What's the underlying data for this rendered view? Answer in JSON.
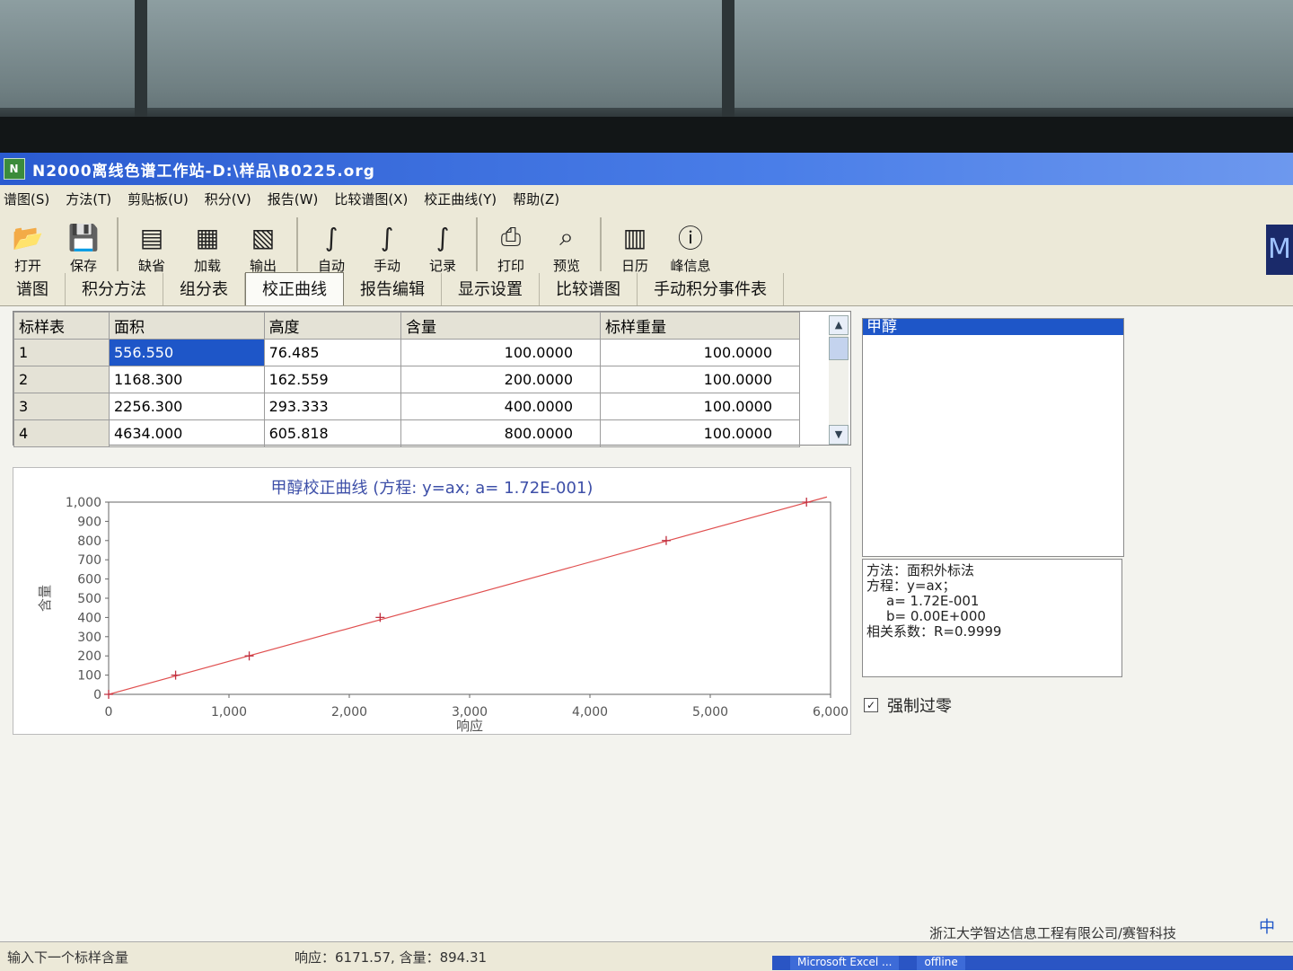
{
  "window": {
    "title": "N2000离线色谱工作站-D:\\样品\\B0225.org"
  },
  "menu": [
    "谱图(S)",
    "方法(T)",
    "剪贴板(U)",
    "积分(V)",
    "报告(W)",
    "比较谱图(X)",
    "校正曲线(Y)",
    "帮助(Z)"
  ],
  "toolbar": [
    {
      "label": "打开",
      "icon": "open-folder-icon"
    },
    {
      "label": "保存",
      "icon": "save-icon"
    },
    {
      "sep": true
    },
    {
      "label": "缺省",
      "icon": "document-icon"
    },
    {
      "label": "加载",
      "icon": "load-icon"
    },
    {
      "label": "输出",
      "icon": "export-icon"
    },
    {
      "sep": true
    },
    {
      "label": "自动",
      "icon": "auto-integrate-icon"
    },
    {
      "label": "手动",
      "icon": "manual-integrate-icon"
    },
    {
      "label": "记录",
      "icon": "record-icon"
    },
    {
      "sep": true
    },
    {
      "label": "打印",
      "icon": "printer-icon"
    },
    {
      "label": "预览",
      "icon": "preview-icon"
    },
    {
      "sep": true
    },
    {
      "label": "日历",
      "icon": "calendar-icon"
    },
    {
      "label": "峰信息",
      "icon": "info-icon"
    }
  ],
  "tabs": [
    "谱图",
    "积分方法",
    "组分表",
    "校正曲线",
    "报告编辑",
    "显示设置",
    "比较谱图",
    "手动积分事件表"
  ],
  "active_tab": "校正曲线",
  "grid": {
    "headers": [
      "标样表",
      "面积",
      "高度",
      "含量",
      "标样重量"
    ],
    "rows": [
      [
        "1",
        "556.550",
        "76.485",
        "100.0000",
        "100.0000"
      ],
      [
        "2",
        "1168.300",
        "162.559",
        "200.0000",
        "100.0000"
      ],
      [
        "3",
        "2256.300",
        "293.333",
        "400.0000",
        "100.0000"
      ],
      [
        "4",
        "4634.000",
        "605.818",
        "800.0000",
        "100.0000"
      ]
    ]
  },
  "component": "甲醇",
  "info": {
    "method": "方法：面积外标法",
    "equation": "方程：y=ax；",
    "a": "a= 1.72E-001",
    "b": "b= 0.00E+000",
    "corr": "相关系数：R=0.9999"
  },
  "force_zero": "强制过零",
  "chart_data": {
    "type": "scatter",
    "title": "甲醇校正曲线 (方程: y=ax; a= 1.72E-001)",
    "xlabel": "响应",
    "ylabel": "含量",
    "xlim": [
      0,
      6000
    ],
    "ylim": [
      0,
      1000
    ],
    "xticks": [
      "0",
      "1,000",
      "2,000",
      "3,000",
      "4,000",
      "5,000",
      "6,000"
    ],
    "yticks": [
      "0",
      "100",
      "200",
      "300",
      "400",
      "500",
      "600",
      "700",
      "800",
      "900",
      "1,000"
    ],
    "points": [
      [
        0,
        0
      ],
      [
        556.55,
        100
      ],
      [
        1168.3,
        200
      ],
      [
        2256.3,
        400
      ],
      [
        4634,
        800
      ],
      [
        5800,
        1000
      ]
    ],
    "fit": {
      "slope": 0.172,
      "intercept": 0,
      "color": "#e05050"
    }
  },
  "company": "浙江大学智达信息工程有限公司/赛智科技",
  "status": {
    "hint": "输入下一个标样含量",
    "response": "响应：6171.57, 含量：894.31"
  },
  "taskbar": [
    "Microsoft Excel ...",
    "offline"
  ],
  "ime": "中"
}
